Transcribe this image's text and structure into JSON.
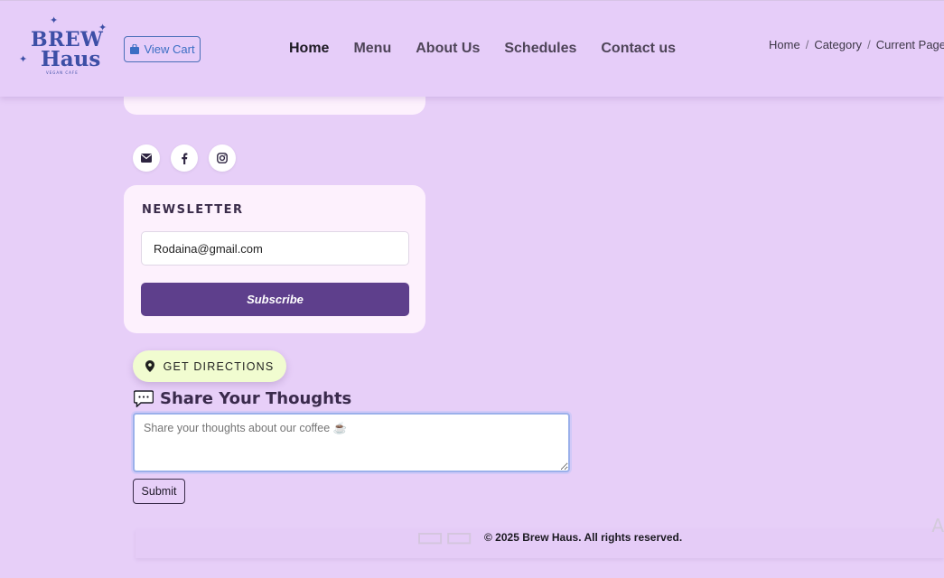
{
  "brand": {
    "line1": "BREW",
    "line2": "Haus",
    "tagline": "VEGAN CAFE"
  },
  "header": {
    "cart_label": "View Cart",
    "nav": [
      {
        "label": "Home",
        "active": true
      },
      {
        "label": "Menu",
        "active": false
      },
      {
        "label": "About Us",
        "active": false
      },
      {
        "label": "Schedules",
        "active": false
      },
      {
        "label": "Contact us",
        "active": false
      }
    ],
    "breadcrumb": [
      "Home",
      "Category",
      "Current Page"
    ]
  },
  "social": {
    "icons": [
      "envelope-icon",
      "facebook-icon",
      "instagram-icon"
    ]
  },
  "newsletter": {
    "title": "NEWSLETTER",
    "email_value": "Rodaina@gmail.com",
    "button_label": "Subscribe"
  },
  "directions": {
    "label": "GET DIRECTIONS"
  },
  "thoughts": {
    "heading": "Share Your Thoughts",
    "placeholder": "Share your thoughts about our coffee ☕",
    "submit_label": "Submit"
  },
  "footer": {
    "copyright": "© 2025 Brew Haus. All rights reserved."
  },
  "colors": {
    "page_bg": "#e7cff8",
    "card_bg": "#fdf1fd",
    "primary_button": "#5e3f8c",
    "directions_bg": "#f1fcd0",
    "brand_blue": "#3d4fa6"
  }
}
